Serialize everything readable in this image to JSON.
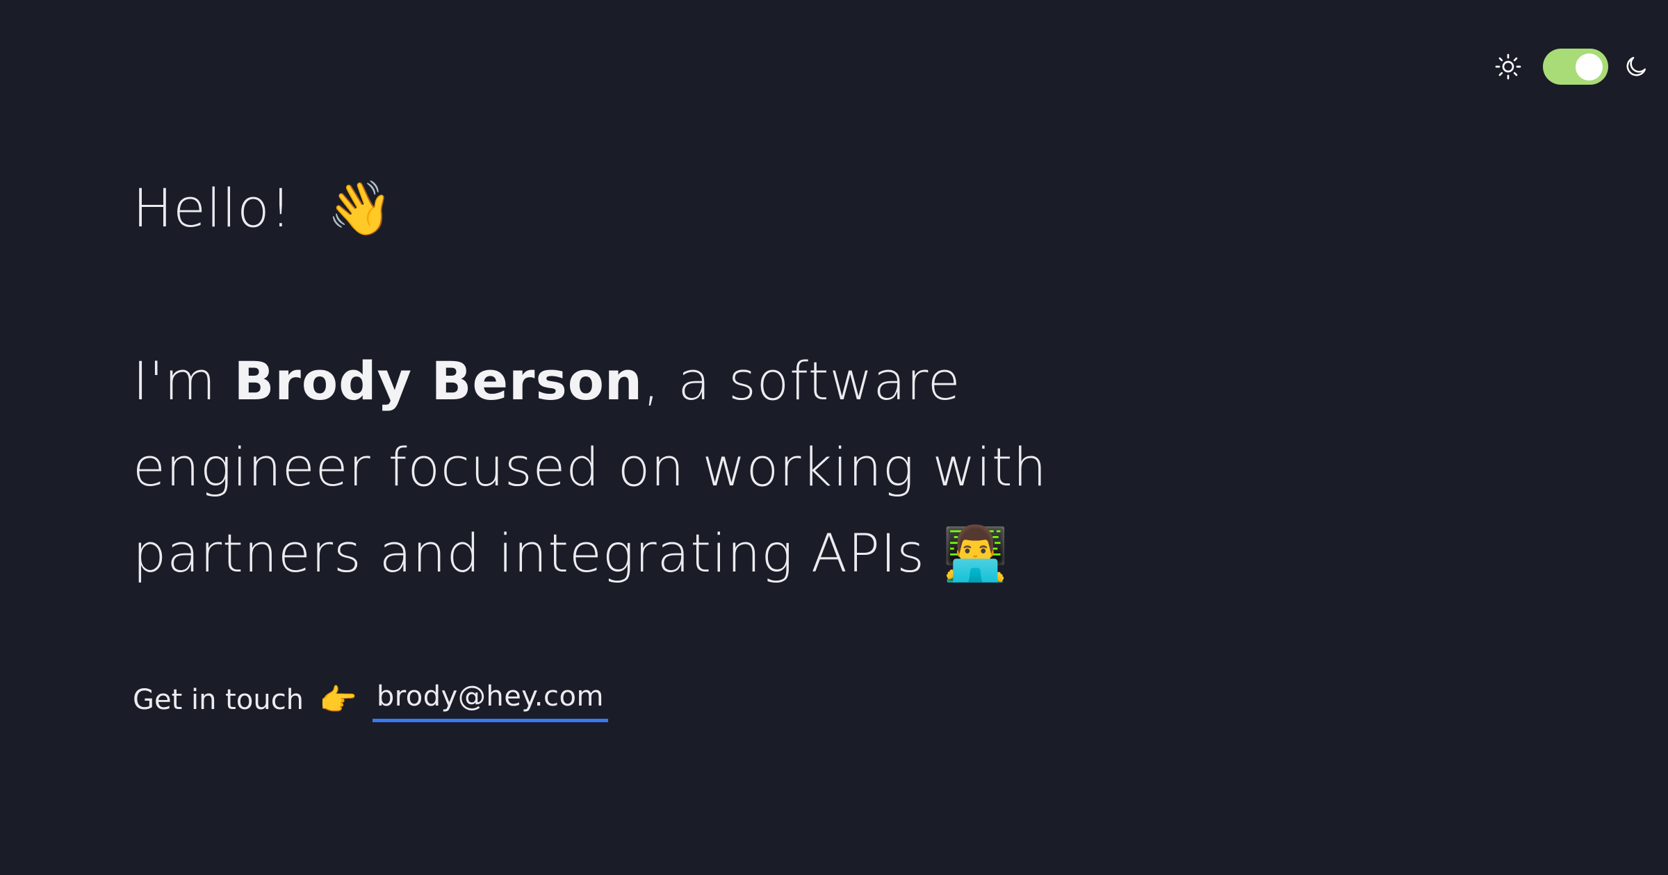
{
  "theme": {
    "accent_on_color": "#a9dc76",
    "background_color": "#1a1d27",
    "link_underline_color": "#3a78f2",
    "toggle_state": "dark",
    "light_icon": "sun-icon",
    "dark_icon": "moon-icon"
  },
  "hero": {
    "greeting": "Hello!",
    "greeting_emoji": "👋",
    "intro_prefix": "I'm ",
    "name": "Brody Berson",
    "intro_suffix": ", a software engineer focused on working with partners and integrating APIs",
    "intro_emoji": "👨‍💻"
  },
  "contact": {
    "label": "Get in touch",
    "pointer_emoji": "👉",
    "email": "brody@hey.com"
  }
}
